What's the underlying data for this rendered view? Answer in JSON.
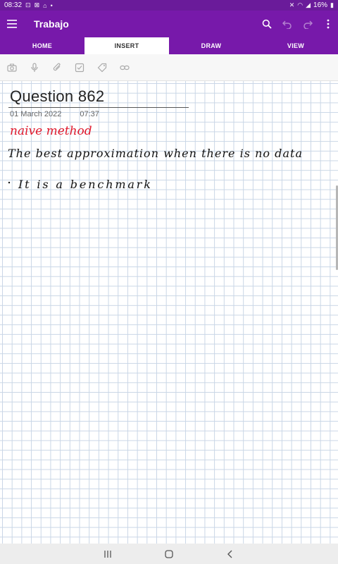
{
  "status_bar": {
    "time": "08:32",
    "battery": "16%",
    "left_icons": [
      "screen-record-icon",
      "mirror-icon",
      "home-icon",
      "dot-icon"
    ],
    "right_icons": [
      "mute-icon",
      "wifi-icon",
      "signal-icon",
      "battery-icon"
    ]
  },
  "app_bar": {
    "title": "Trabajo",
    "actions": [
      "search-icon",
      "undo-icon",
      "redo-icon",
      "more-icon"
    ]
  },
  "tabs": [
    {
      "label": "HOME",
      "active": false
    },
    {
      "label": "INSERT",
      "active": true
    },
    {
      "label": "DRAW",
      "active": false
    },
    {
      "label": "VIEW",
      "active": false
    }
  ],
  "ribbon_tools": [
    "camera-icon",
    "microphone-icon",
    "attachment-icon",
    "checklist-icon",
    "tag-icon",
    "link-icon"
  ],
  "note": {
    "title": "Question  862",
    "date": "01 March 2022",
    "time": "07:37",
    "ink": {
      "heading": "naive method",
      "line_1": "The best approximation when there is no data",
      "line_2": "It is a benchmark",
      "heading_color": "#e0192c",
      "text_color": "#111111"
    }
  },
  "nav_bar": [
    "recents-icon",
    "home-icon",
    "back-icon"
  ],
  "colors": {
    "brand": "#7719aa",
    "status": "#6a1b9a",
    "grid": "#c9d6e6"
  }
}
